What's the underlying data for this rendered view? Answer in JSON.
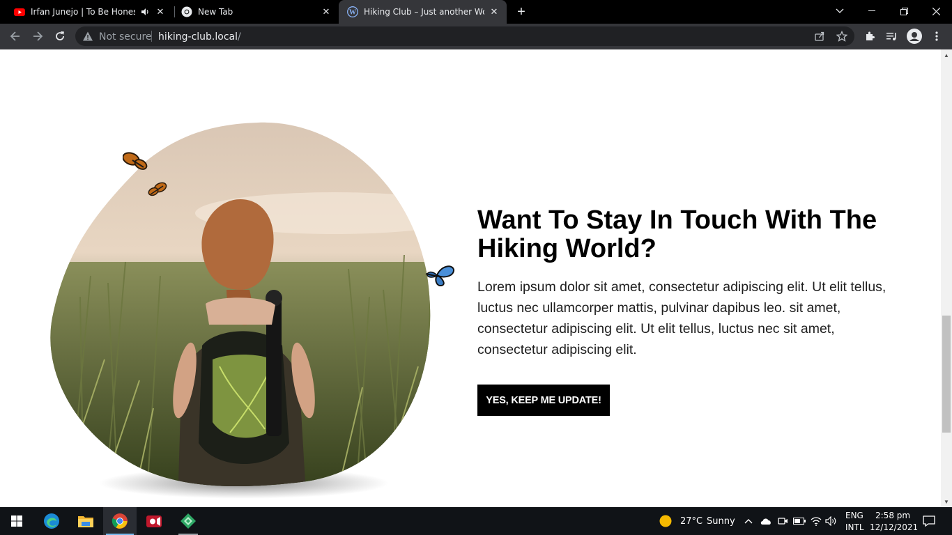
{
  "browser": {
    "tabs": [
      {
        "label": "Irfan Junejo | To Be Honest | Hiking Vlog",
        "favicon": "youtube-icon",
        "audio": true,
        "active": false
      },
      {
        "label": "New Tab",
        "favicon": "chrome-icon",
        "audio": false,
        "active": false
      },
      {
        "label": "Hiking Club – Just another WordPress site",
        "favicon": "wordpress-icon",
        "audio": false,
        "active": true
      }
    ],
    "omnibox": {
      "security_label": "Not secure",
      "url_host": "hiking-club.local",
      "url_path": "/"
    }
  },
  "page": {
    "heading": "Want To Stay In Touch With The Hiking World?",
    "paragraph": "Lorem ipsum dolor sit amet, consectetur adipiscing elit. Ut elit tellus, luctus nec ullamcorper mattis, pulvinar dapibus leo. sit amet, consectetur adipiscing elit. Ut elit tellus, luctus nec sit amet, consectetur adipiscing elit.",
    "cta_label": "YES, KEEP ME UPDATE!"
  },
  "taskbar": {
    "apps": [
      "start-icon",
      "edge-icon",
      "file-explorer-icon",
      "chrome-icon",
      "screen-recorder-icon",
      "app-icon"
    ],
    "weather": {
      "temperature": "27°C",
      "condition": "Sunny"
    },
    "language": {
      "line1": "ENG",
      "line2": "INTL"
    },
    "clock": {
      "time": "2:58 pm",
      "date": "12/12/2021"
    }
  },
  "colors": {
    "tab_strip": "#000000",
    "toolbar": "#35363a",
    "omnibox": "#202124",
    "cta_bg": "#000000",
    "cta_text": "#ffffff",
    "taskbar": "#101317"
  }
}
